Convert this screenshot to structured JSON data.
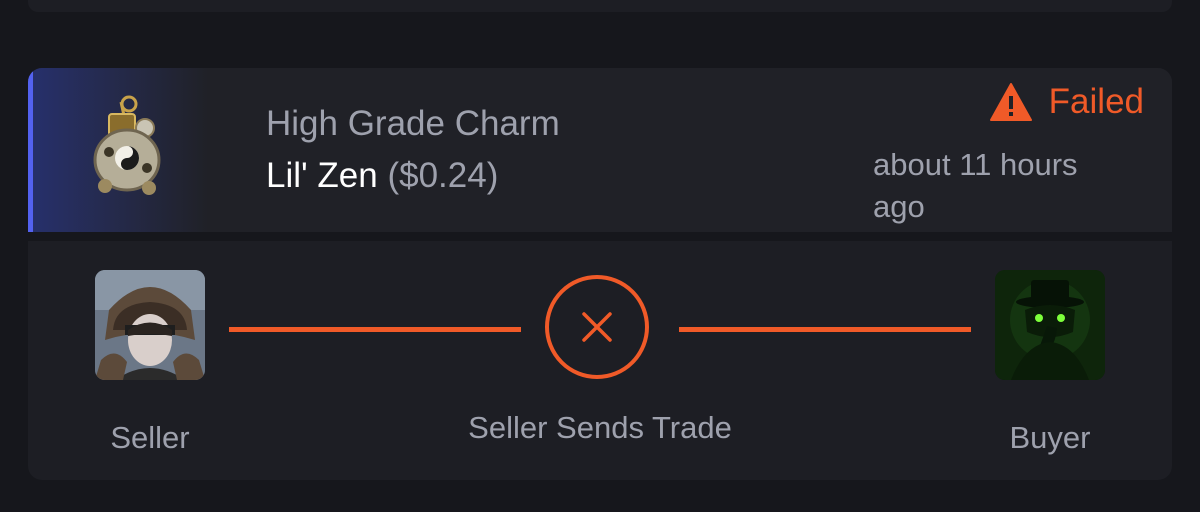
{
  "trade": {
    "item_type": "High Grade Charm",
    "item_name": "Lil' Zen",
    "item_price": "($0.24)",
    "status": "Failed",
    "time_ago": "about 11 hours ago"
  },
  "progress": {
    "seller_label": "Seller",
    "step_label": "Seller Sends Trade",
    "buyer_label": "Buyer"
  },
  "colors": {
    "accent": "#5362f0",
    "failed": "#f05a28",
    "muted_text": "#9ea1ad",
    "card_bg": "#1d1e24"
  },
  "icons": {
    "status": "warning-triangle-icon",
    "step": "close-x-icon"
  }
}
